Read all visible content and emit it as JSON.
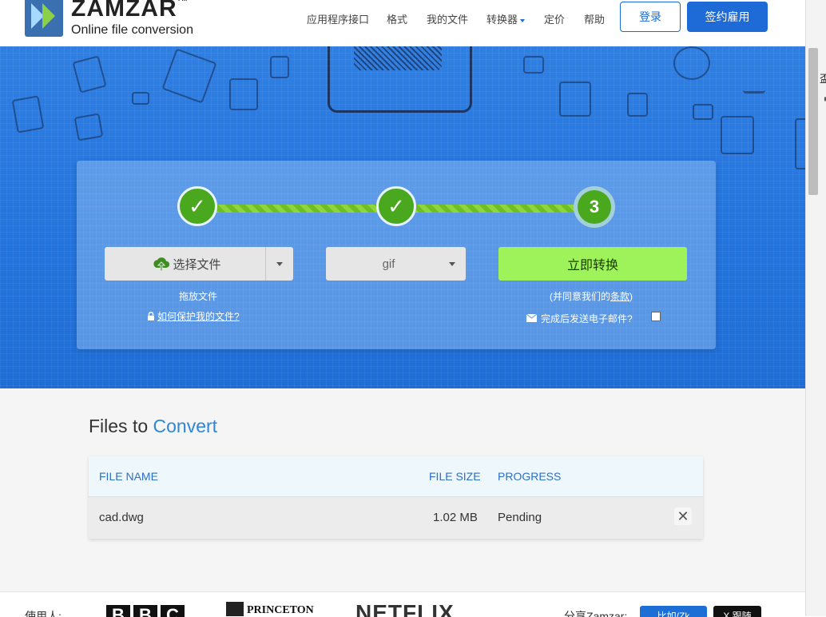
{
  "header": {
    "brand": "ZAMZAR",
    "tm": "TM",
    "tagline": "Online file conversion",
    "nav": [
      "应用程序接口",
      "格式",
      "我的文件",
      "转换器",
      "定价",
      "帮助"
    ],
    "login": "登录",
    "signup": "签约雇用"
  },
  "steps": {
    "step1": "✓",
    "step2": "✓",
    "step3": "3"
  },
  "upload": {
    "choose_label": "选择文件",
    "drop_hint": "拖放文件",
    "protect_link": "如何保护我的文件?"
  },
  "format": {
    "selected": "gif"
  },
  "convert": {
    "label": "立即转换",
    "terms_prefix": "(并同意我们的",
    "terms_link": "条款",
    "terms_suffix": ")",
    "email_label": "完成后发送电子邮件?"
  },
  "files": {
    "title_prefix": "Files to",
    "title_accent": "Convert",
    "columns": [
      "FILE NAME",
      "FILE SIZE",
      "PROGRESS"
    ],
    "rows": [
      {
        "name": "cad.dwg",
        "size": "1.02 MB",
        "progress": "Pending"
      }
    ],
    "remove_glyph": "✕"
  },
  "strip": {
    "used_by": "使用人:",
    "bbc": [
      "B",
      "B",
      "C"
    ],
    "princeton": "PRINCETON",
    "netflix": "NETFLIX",
    "share": "分享Zamzar:",
    "like": "比如/Zk",
    "follow": "X 跟随"
  },
  "sidebar": {
    "t1": "盃",
    "t2": "ᅤ"
  },
  "colors": {
    "primary": "#1e6ad6",
    "hero": "#2374de",
    "success": "#4aa81e",
    "convert_bg": "#9ef35a",
    "accent_text": "#2f86d4"
  },
  "icons": {
    "upload": "cloud-upload-icon",
    "lock": "lock-icon",
    "mail": "envelope-icon",
    "check": "checkmark-icon",
    "close": "close-icon",
    "dropdown": "chevron-down-icon"
  }
}
